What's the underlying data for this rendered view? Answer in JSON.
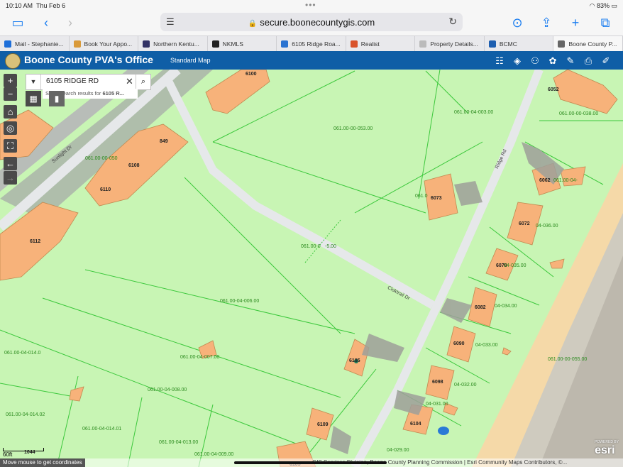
{
  "status": {
    "time": "10:10 AM",
    "date": "Thu Feb 6",
    "battery": "83%"
  },
  "browser": {
    "url": "secure.boonecountygis.com",
    "tabs": [
      {
        "label": "Mail - Stephanie...",
        "color": "#1e6fd9"
      },
      {
        "label": "Book Your Appo...",
        "color": "#d99a3a"
      },
      {
        "label": "Northern Kentu...",
        "color": "#333366"
      },
      {
        "label": "NKMLS",
        "color": "#222222"
      },
      {
        "label": "6105 Ridge Roa...",
        "color": "#2a73d1"
      },
      {
        "label": "Realist",
        "color": "#d9532b"
      },
      {
        "label": "Property Details...",
        "color": "#bbbbbb"
      },
      {
        "label": "BCMC",
        "color": "#1e5fb0"
      },
      {
        "label": "Boone County P...",
        "color": "#666666"
      }
    ]
  },
  "app": {
    "title": "Boone County PVA's Office",
    "basemap": "Standard Map"
  },
  "search": {
    "value": "6105 RIDGE RD",
    "suggestion_prefix": "Show search results for ",
    "suggestion_term": "6105 R..."
  },
  "map": {
    "road_labels": [
      "Sunlight Dr",
      "Ridge Rd",
      "Cloktrail Dr"
    ],
    "house_numbers": [
      "6100",
      "6052",
      "849",
      "6108",
      "6110",
      "6112",
      "6073",
      "6062",
      "6072",
      "6078",
      "6082",
      "6090",
      "6105",
      "6098",
      "6104",
      "6109",
      "1044",
      "6105"
    ],
    "parcel_ids": [
      "061.00-04-003.00",
      "061.00-00-038.00",
      "061.00-00-053.00",
      "061.00-00-050",
      "061.0",
      "061.00-04-",
      "04-036.00",
      "061.00-0",
      "-5.00",
      "04-035.00",
      "061.00-04-006.00",
      "04-034.00",
      "061.00-04-014.0",
      "061.00-04-007.00",
      "04-033.00",
      "061.00-00-055.00",
      "061.00-04-008.00",
      "04-032.00",
      "061.00-04-014.02",
      "04-031.00",
      "061.00-04-014.01",
      "061.00-04-013.00",
      "061.00-04-009.00",
      "04-029.00"
    ]
  },
  "footer": {
    "scale": "60ft",
    "coords_hint": "Move mouse to get coordinates",
    "credits": "GIS Services Division, Boone County Planning Commission | Esri Community Maps Contributors, ©...",
    "esri": "esri",
    "powered": "POWERED BY"
  },
  "colors": {
    "parcel_fill": "#c8f5b4",
    "parcel_line": "#3cc83c",
    "building": "#f7b27a",
    "road": "#e6e8ea",
    "header": "#0f5ea6",
    "label": "#2b8a1e"
  }
}
